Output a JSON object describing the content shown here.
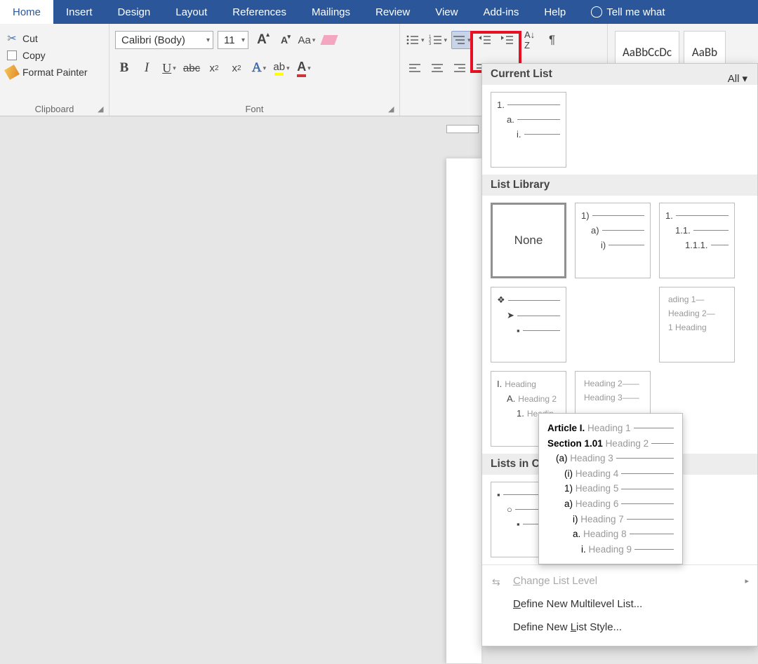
{
  "tabs": [
    "Home",
    "Insert",
    "Design",
    "Layout",
    "References",
    "Mailings",
    "Review",
    "View",
    "Add-ins",
    "Help"
  ],
  "active_tab": "Home",
  "tell_me": "Tell me what",
  "clipboard": {
    "cut": "Cut",
    "copy": "Copy",
    "painter": "Format Painter",
    "label": "Clipboard"
  },
  "font": {
    "name": "Calibri (Body)",
    "size": "11",
    "case_label": "Aa",
    "label": "Font"
  },
  "styles": {
    "preview1": "AaBbCcDc",
    "preview2": "AaBb"
  },
  "ml_panel": {
    "all": "All",
    "section_current": "Current List",
    "section_library": "List Library",
    "section_docs": "Lists in Current Documents",
    "none": "None",
    "menu_change": "Change List Level",
    "menu_define_ml": "Define New Multilevel List...",
    "menu_define_style": "Define New List Style...",
    "tooltip_lines": [
      {
        "lvl": 1,
        "prefix": "Article I.",
        "label": "Heading 1"
      },
      {
        "lvl": 1,
        "prefix": "Section 1.01",
        "label": "Heading 2"
      },
      {
        "lvl": 2,
        "prefix": "(a)",
        "label": "Heading 3"
      },
      {
        "lvl": 3,
        "prefix": "(i)",
        "label": "Heading 4"
      },
      {
        "lvl": 3,
        "prefix": "1)",
        "label": "Heading 5"
      },
      {
        "lvl": 3,
        "prefix": "a)",
        "label": "Heading 6"
      },
      {
        "lvl": 4,
        "prefix": "i)",
        "label": "Heading 7"
      },
      {
        "lvl": 4,
        "prefix": "a.",
        "label": "Heading 8"
      },
      {
        "lvl": 5,
        "prefix": "i.",
        "label": "Heading 9"
      }
    ],
    "lib_1paren": [
      "1)",
      "a)",
      "i)"
    ],
    "lib_1dot": [
      "1.",
      "1.1.",
      "1.1.1."
    ],
    "lib_heading_partial": [
      "ading 1—",
      "Heading 2—",
      "1 Heading"
    ],
    "lib_roman": {
      "a": "I.",
      "b": "A.",
      "c": "1.",
      "la": "Heading",
      "lb": "Heading 2",
      "lc": "Headin"
    },
    "lib_heading_b": [
      "Heading 2——",
      "Heading 3——"
    ]
  }
}
